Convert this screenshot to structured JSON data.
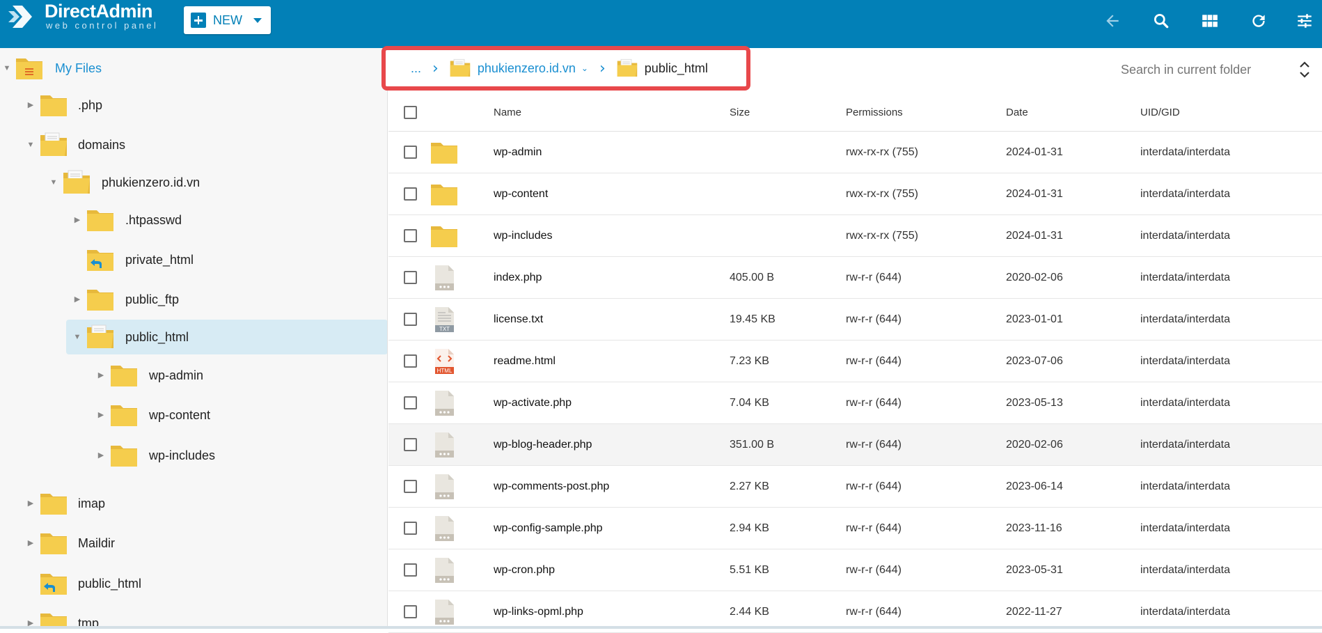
{
  "app": {
    "logo_title": "DirectAdmin",
    "logo_subtitle": "web control panel",
    "new_button": "NEW",
    "accent": "#0280b7"
  },
  "toolbar": {
    "icons": [
      "back-icon",
      "search-icon",
      "grid-view-icon",
      "refresh-icon",
      "settings-sliders-icon"
    ]
  },
  "sidebar": {
    "items": [
      {
        "label": "My Files"
      },
      {
        "label": ".php"
      },
      {
        "label": "domains"
      },
      {
        "label": "phukienzero.id.vn"
      },
      {
        "label": ".htpasswd"
      },
      {
        "label": "private_html"
      },
      {
        "label": "public_ftp"
      },
      {
        "label": "public_html"
      },
      {
        "label": "wp-admin"
      },
      {
        "label": "wp-content"
      },
      {
        "label": "wp-includes"
      },
      {
        "label": "imap"
      },
      {
        "label": "Maildir"
      },
      {
        "label": "public_html"
      },
      {
        "label": "tmp"
      }
    ]
  },
  "breadcrumb": {
    "ellipsis": "...",
    "domain": "phukienzero.id.vn",
    "current": "public_html"
  },
  "search": {
    "placeholder": "Search in current folder"
  },
  "table": {
    "headers": {
      "name": "Name",
      "size": "Size",
      "permissions": "Permissions",
      "date": "Date",
      "uid": "UID/GID"
    },
    "rows": [
      {
        "type": "folder",
        "name": "wp-admin",
        "size": "",
        "permissions": "rwx-rx-rx (755)",
        "date": "2024-01-31",
        "uid": "interdata/interdata"
      },
      {
        "type": "folder",
        "name": "wp-content",
        "size": "",
        "permissions": "rwx-rx-rx (755)",
        "date": "2024-01-31",
        "uid": "interdata/interdata"
      },
      {
        "type": "folder",
        "name": "wp-includes",
        "size": "",
        "permissions": "rwx-rx-rx (755)",
        "date": "2024-01-31",
        "uid": "interdata/interdata"
      },
      {
        "type": "file",
        "name": "index.php",
        "size": "405.00 B",
        "permissions": "rw-r-r (644)",
        "date": "2020-02-06",
        "uid": "interdata/interdata"
      },
      {
        "type": "txt",
        "name": "license.txt",
        "size": "19.45 KB",
        "permissions": "rw-r-r (644)",
        "date": "2023-01-01",
        "uid": "interdata/interdata"
      },
      {
        "type": "html",
        "name": "readme.html",
        "size": "7.23 KB",
        "permissions": "rw-r-r (644)",
        "date": "2023-07-06",
        "uid": "interdata/interdata"
      },
      {
        "type": "file",
        "name": "wp-activate.php",
        "size": "7.04 KB",
        "permissions": "rw-r-r (644)",
        "date": "2023-05-13",
        "uid": "interdata/interdata"
      },
      {
        "type": "file",
        "name": "wp-blog-header.php",
        "size": "351.00 B",
        "permissions": "rw-r-r (644)",
        "date": "2020-02-06",
        "uid": "interdata/interdata"
      },
      {
        "type": "file",
        "name": "wp-comments-post.php",
        "size": "2.27 KB",
        "permissions": "rw-r-r (644)",
        "date": "2023-06-14",
        "uid": "interdata/interdata"
      },
      {
        "type": "file",
        "name": "wp-config-sample.php",
        "size": "2.94 KB",
        "permissions": "rw-r-r (644)",
        "date": "2023-11-16",
        "uid": "interdata/interdata"
      },
      {
        "type": "file",
        "name": "wp-cron.php",
        "size": "5.51 KB",
        "permissions": "rw-r-r (644)",
        "date": "2023-05-31",
        "uid": "interdata/interdata"
      },
      {
        "type": "file",
        "name": "wp-links-opml.php",
        "size": "2.44 KB",
        "permissions": "rw-r-r (644)",
        "date": "2022-11-27",
        "uid": "interdata/interdata"
      }
    ],
    "txt_badge": "TXT",
    "html_badge": "HTML"
  }
}
